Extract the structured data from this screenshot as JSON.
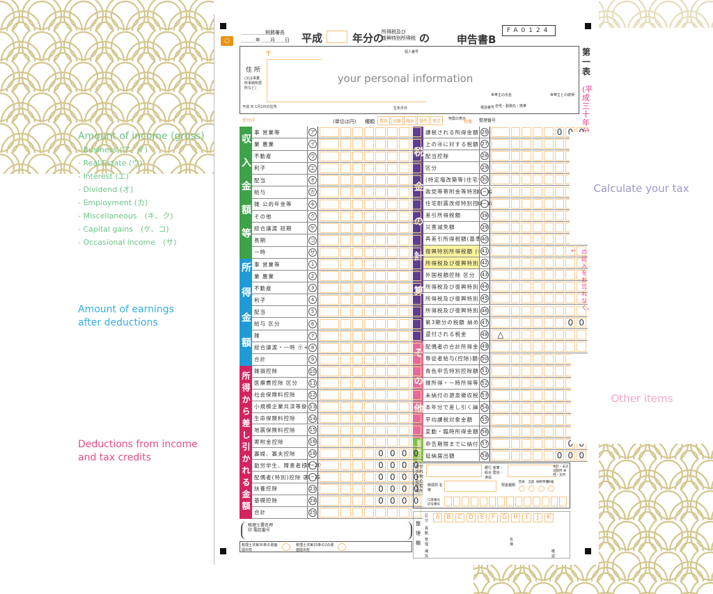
{
  "colors": {
    "income": "#3ea24a",
    "earnings": "#1e9bd7",
    "deductions": "#d3245f",
    "tax": "#5b3e92",
    "other": "#e66a9b",
    "extension": "#7cc242",
    "fan": "#d4c68e",
    "orange": "#f7c98c"
  },
  "header": {
    "tax_office": "税務署長",
    "date": "年＿＿月＿＿日",
    "era": "平成",
    "year_suffix": "年分の",
    "tax_type_1": "所得税及び",
    "tax_type_2": "復興特別所得税",
    "of": "の",
    "form_name": "申告書B",
    "form_code": "FA0124",
    "sheet": "第一表",
    "sheet_note": "(平成三十年分",
    "comment_icon": "speech-bubble-icon"
  },
  "personal": {
    "postal_mark": "〒",
    "address_label": "住 所",
    "address_alt": "(又は事業所事務所居所など)",
    "my_number": "個人番号",
    "householder": "世帯主の氏名",
    "relation": "世帯主との続柄",
    "phone_label": "電話番号",
    "phone_types": "自宅・勤務先・携帯",
    "birth": "生年月日",
    "jan1_address": "平成 年 1月1日の住所",
    "overlay": "your personal information"
  },
  "unit": "(単位は円)",
  "kinds_label": "種類",
  "kinds": [
    "青色",
    "分離",
    "国出",
    "損失",
    "修正"
  ],
  "special": "特農の表示",
  "tokuno": "特農",
  "seiri": "整理番号",
  "receipt": "受付印",
  "sections": {
    "income": "収入金額等",
    "earnings": "所得金額",
    "deductions": "所得から差し引かれる金額",
    "tax": "税金の計算",
    "other": "その他",
    "extension": "延届納の出"
  },
  "income_rows": [
    {
      "n": "ア",
      "label": "事 営業等"
    },
    {
      "n": "イ",
      "label": "業 農業"
    },
    {
      "n": "ウ",
      "label": "不動産"
    },
    {
      "n": "エ",
      "label": "利子"
    },
    {
      "n": "オ",
      "label": "配当"
    },
    {
      "n": "カ",
      "label": "給与"
    },
    {
      "n": "キ",
      "label": "雑 公的年金等"
    },
    {
      "n": "ク",
      "label": "その他"
    },
    {
      "n": "ケ",
      "label": "総合譲渡 短期"
    },
    {
      "n": "コ",
      "label": "長期"
    },
    {
      "n": "サ",
      "label": "一時"
    }
  ],
  "earnings_rows": [
    {
      "n": "1",
      "label": "事 営業等"
    },
    {
      "n": "2",
      "label": "業 農業"
    },
    {
      "n": "3",
      "label": "不動産"
    },
    {
      "n": "4",
      "label": "利子"
    },
    {
      "n": "5",
      "label": "配当"
    },
    {
      "n": "6",
      "label": "給与 区分"
    },
    {
      "n": "7",
      "label": "雑"
    },
    {
      "n": "8",
      "label": "総合譲渡・一時 ㋘+{(㋙+㋚)×½}"
    },
    {
      "n": "9",
      "label": "合計"
    }
  ],
  "deduction_rows": [
    {
      "n": "10",
      "label": "雑損控除"
    },
    {
      "n": "11",
      "label": "医療費控除 区分"
    },
    {
      "n": "12",
      "label": "社会保険料控除"
    },
    {
      "n": "13",
      "label": "小規模企業共済等掛金控除"
    },
    {
      "n": "14",
      "label": "生命保険料控除"
    },
    {
      "n": "15",
      "label": "地震保険料控除"
    },
    {
      "n": "16",
      "label": "寄附金控除"
    },
    {
      "n": "18",
      "label": "寡婦、寡夫控除",
      "prefill": "0000"
    },
    {
      "n": "19~20",
      "label": "勤労学生、障害者控除",
      "prefill": "0000"
    },
    {
      "n": "21~22",
      "label": "配偶者(特別)控除 区分",
      "prefill": "0000"
    },
    {
      "n": "23",
      "label": "扶養控除",
      "prefill": "0000"
    },
    {
      "n": "24",
      "label": "基礎控除",
      "prefill": "0000"
    },
    {
      "n": "25",
      "label": "合計"
    }
  ],
  "tax_rows": [
    {
      "n": "26",
      "label": "課税される所得金額 (⑨−㉕)又は第三表",
      "prefill": "000"
    },
    {
      "n": "27",
      "label": "上の㉖に対する税額 又は第三表の㊿"
    },
    {
      "n": "28",
      "label": "配当控除"
    },
    {
      "n": "29",
      "label": "区分"
    },
    {
      "n": "30",
      "label": "(特定増改築等)住宅借入金等特別控除 区分",
      "prefill": "0"
    },
    {
      "n": "31~32",
      "label": "政党等寄附金等特別控除"
    },
    {
      "n": "33~37",
      "label": "住宅耐震改修特別控除等 区分"
    },
    {
      "n": "38",
      "label": "差引所得税額"
    },
    {
      "n": "39",
      "label": "災害減免額"
    },
    {
      "n": "40",
      "label": "再差引所得税額(基準所得税額)"
    },
    {
      "n": "41",
      "label": "復興特別所得税額 (㊵×2.1%)",
      "hl": true
    },
    {
      "n": "42",
      "label": "所得税及び復興特別所得税の額 (㊵+㊶)",
      "hl": true
    },
    {
      "n": "43",
      "label": "外国税額控除 区分"
    },
    {
      "n": "44",
      "label": "所得税及び復興特別所得税の源泉徴収税額"
    },
    {
      "n": "45",
      "label": "所得税及び復興特別所得税の申告納税額"
    },
    {
      "n": "46",
      "label": "所得税及び復興特別所得税の予定納税額(第1期分・第2期分)"
    },
    {
      "n": "47",
      "label": "第3期分の税額 納める税金",
      "prefill": "00"
    },
    {
      "n": "48",
      "label": "還付される税金",
      "prefill": "△"
    }
  ],
  "other_rows": [
    {
      "n": "49",
      "label": "配偶者の合計所得金額"
    },
    {
      "n": "50",
      "label": "専従者給与(控除)額の合計額"
    },
    {
      "n": "51",
      "label": "青色申告特別控除額"
    },
    {
      "n": "52",
      "label": "雑所得・一時所得等の源泉徴収税額の合計額"
    },
    {
      "n": "53",
      "label": "未納付の源泉徴収税額"
    },
    {
      "n": "54",
      "label": "本年分で差し引く繰越損失額"
    },
    {
      "n": "55",
      "label": "平均課税対象金額"
    },
    {
      "n": "56",
      "label": "変動・臨時所得金額 区分"
    }
  ],
  "extension_rows": [
    {
      "n": "57",
      "label": "申告期限までに納付する金額",
      "prefill": "00"
    },
    {
      "n": "58",
      "label": "延納届出額",
      "prefill": "000"
    }
  ],
  "refund": {
    "label": "還付される税金の受取場所",
    "bank": "銀行 金庫・組合 農協・漁協",
    "branch": "本店・支店 出張所 本所・支所",
    "post": "郵便局 名等",
    "deposit": "預金種類",
    "types": [
      "普通",
      "当座",
      "納税準備",
      "貯蓄"
    ],
    "account": "口座番号 記号番号"
  },
  "admin": {
    "label": "整理欄",
    "kubun": "区分",
    "letters": [
      "A",
      "B",
      "C",
      "D",
      "E",
      "F",
      "G",
      "H",
      "I",
      "J",
      "K",
      "L"
    ],
    "ido": "異動",
    "kanri": "管理",
    "meibo": "名簿",
    "hokan": "補完",
    "kakunin": "確認"
  },
  "accountant": {
    "label": "税理士署名押印 電話番号",
    "art30": "税理士法第30条の書面提出有",
    "art33": "税理士法第33条の2の書面提出有"
  },
  "side_note": "の記入をお忘れなく。",
  "annotations": {
    "income_title": "Amount of income (gross)",
    "income_items": [
      "- Business (ア、イ)",
      "- Real Estate (ウ)",
      "- Interest (エ)",
      "- Dividend (オ)",
      "- Employment (カ)",
      "- Miscellaneous　(キ、ク)",
      "- Capital gains　(ケ、コ)",
      "- Occasional income　(サ)"
    ],
    "earnings_1": "Amount of earnings",
    "earnings_2": "after deductions",
    "deductions_1": "Deductions from income",
    "deductions_2": "and tax credits",
    "tax": "Calculate your tax",
    "other": "Other items"
  }
}
